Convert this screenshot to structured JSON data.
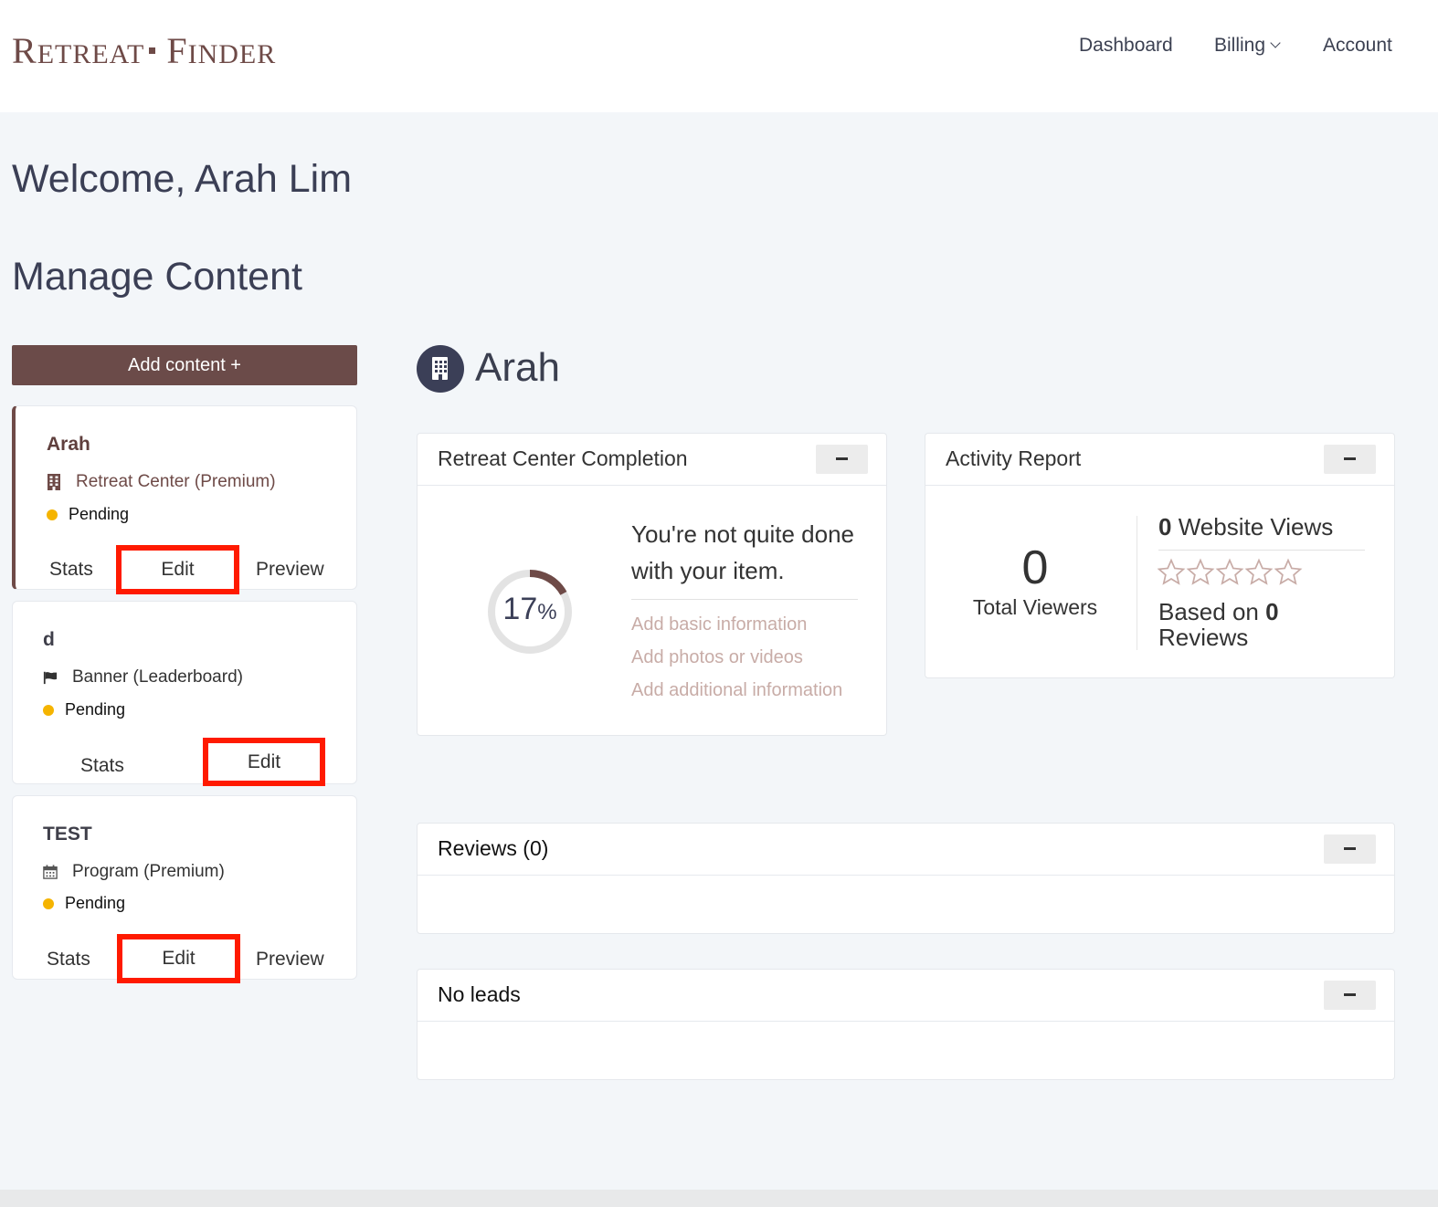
{
  "header": {
    "logo_word1_initial": "R",
    "logo_word1_rest": "ETREAT",
    "logo_word2_initial": "F",
    "logo_word2_rest": "INDER",
    "nav": {
      "dashboard": "Dashboard",
      "billing": "Billing",
      "account": "Account"
    }
  },
  "welcome": "Welcome, Arah Lim",
  "manage_heading": "Manage Content",
  "add_content_label": "Add content +",
  "cards": [
    {
      "title": "Arah",
      "type": "Retreat Center (Premium)",
      "type_icon": "building-icon",
      "status": "Pending",
      "actions": {
        "stats": "Stats",
        "edit": "Edit",
        "preview": "Preview"
      }
    },
    {
      "title": "d",
      "type": "Banner (Leaderboard)",
      "type_icon": "flag-icon",
      "status": "Pending",
      "actions": {
        "stats": "Stats",
        "edit": "Edit"
      }
    },
    {
      "title": "TEST",
      "type": "Program (Premium)",
      "type_icon": "calendar-icon",
      "status": "Pending",
      "actions": {
        "stats": "Stats",
        "edit": "Edit",
        "preview": "Preview"
      }
    }
  ],
  "selected_item": {
    "name": "Arah",
    "icon": "building-icon"
  },
  "completion": {
    "title": "Retreat Center Completion",
    "percent_value": 17,
    "percent_number": "17",
    "percent_sign": "%",
    "message": "You're not quite done with your item.",
    "todos": [
      "Add basic information",
      "Add photos or videos",
      "Add additional information"
    ]
  },
  "activity": {
    "title": "Activity Report",
    "total_viewers_count": "0",
    "total_viewers_label": "Total Viewers",
    "website_views_count": "0",
    "website_views_label": "Website Views",
    "rating_stars": 0,
    "rating_max": 5,
    "based_on_prefix": "Based on",
    "reviews_count": "0",
    "reviews_suffix": "Reviews"
  },
  "reviews_panel": {
    "title": "Reviews (0)"
  },
  "leads_panel": {
    "title": "No leads"
  },
  "colors": {
    "brand": "#6e4a47",
    "button": "#6b4b49",
    "navy": "#3b3f57",
    "pending": "#f5b400",
    "highlight": "#ff1a00",
    "todo_link": "#c8aca7"
  }
}
